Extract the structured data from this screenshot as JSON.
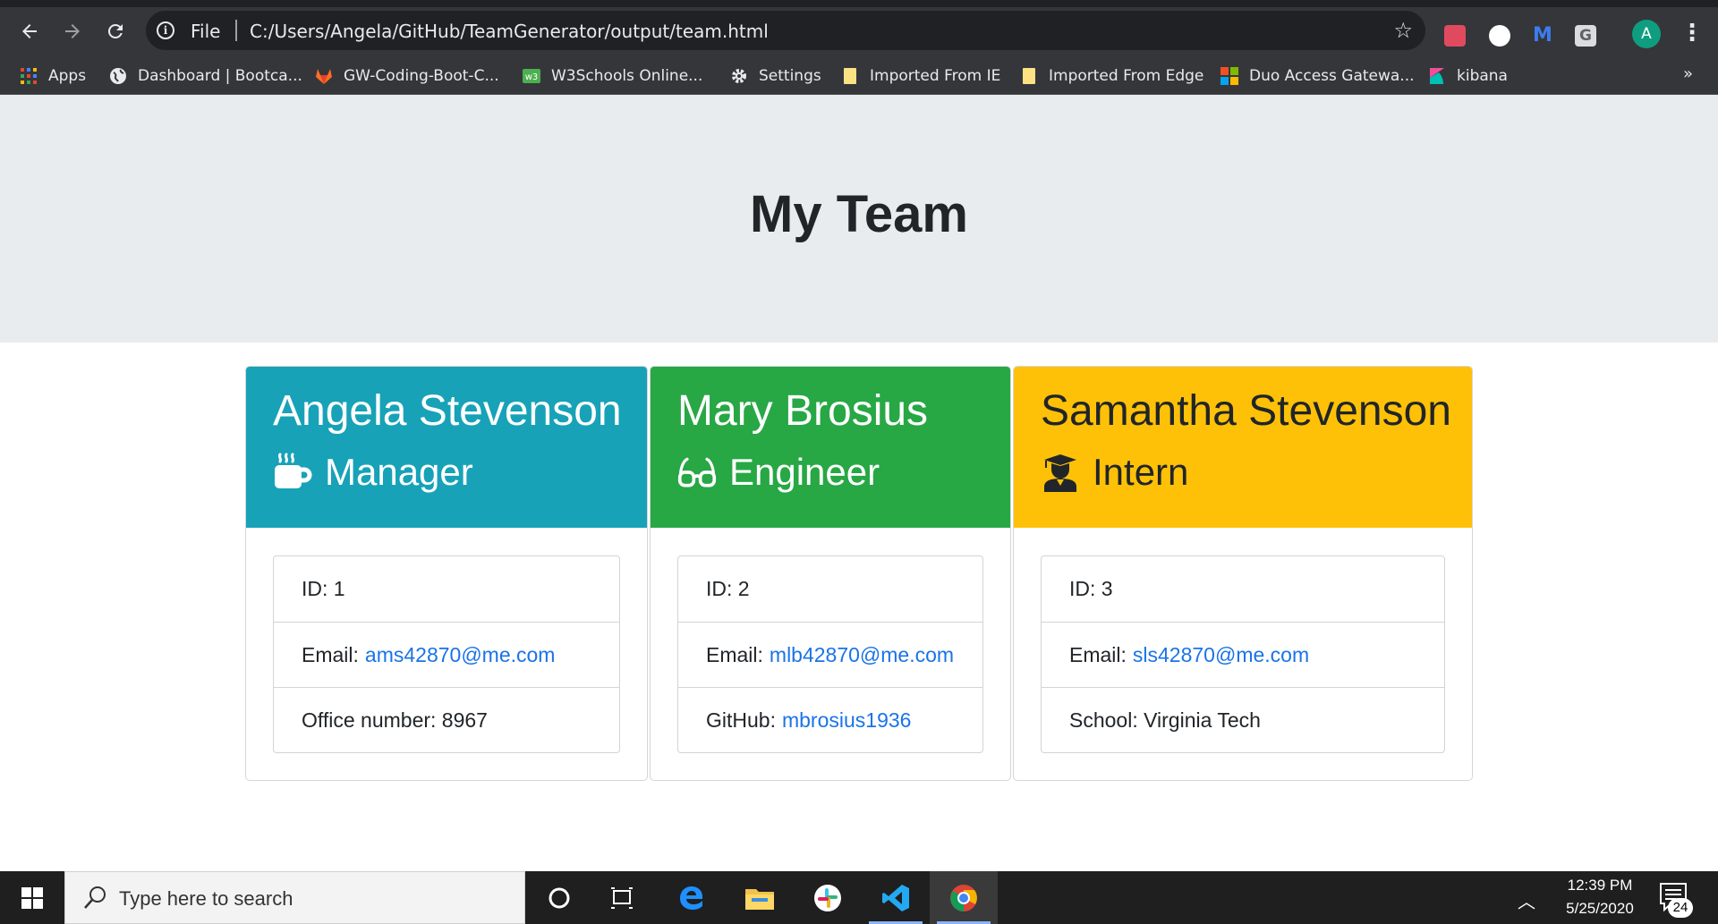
{
  "browser": {
    "url_scheme": "File",
    "url": "C:/Users/Angela/GitHub/TeamGenerator/output/team.html",
    "profile_initial": "A",
    "bookmarks": [
      {
        "label": "Apps"
      },
      {
        "label": "Dashboard | Bootca..."
      },
      {
        "label": "GW-Coding-Boot-C..."
      },
      {
        "label": "W3Schools Online..."
      },
      {
        "label": "Settings"
      },
      {
        "label": "Imported From IE"
      },
      {
        "label": "Imported From Edge"
      },
      {
        "label": "Duo Access Gatewa..."
      },
      {
        "label": "kibana"
      }
    ],
    "more_label": "»"
  },
  "page": {
    "title": "My Team",
    "cards": [
      {
        "name": "Angela Stevenson",
        "role": "Manager",
        "role_icon": "coffee-mug-icon",
        "color": "#17a2b8",
        "id_label": "ID: 1",
        "email_prefix": "Email:",
        "email": "ams42870@me.com",
        "extra_label": "Office number: 8967",
        "extra_link": ""
      },
      {
        "name": "Mary Brosius",
        "role": "Engineer",
        "role_icon": "glasses-icon",
        "color": "#28a745",
        "id_label": "ID: 2",
        "email_prefix": "Email:",
        "email": "mlb42870@me.com",
        "extra_label": "GitHub:",
        "extra_link": "mbrosius1936"
      },
      {
        "name": "Samantha Stevenson",
        "role": "Intern",
        "role_icon": "graduate-icon",
        "color": "#ffc107",
        "id_label": "ID: 3",
        "email_prefix": "Email:",
        "email": "sls42870@me.com",
        "extra_label": "School: Virginia Tech",
        "extra_link": ""
      }
    ]
  },
  "taskbar": {
    "search_placeholder": "Type here to search",
    "time": "12:39 PM",
    "date": "5/25/2020",
    "notification_count": "24"
  }
}
